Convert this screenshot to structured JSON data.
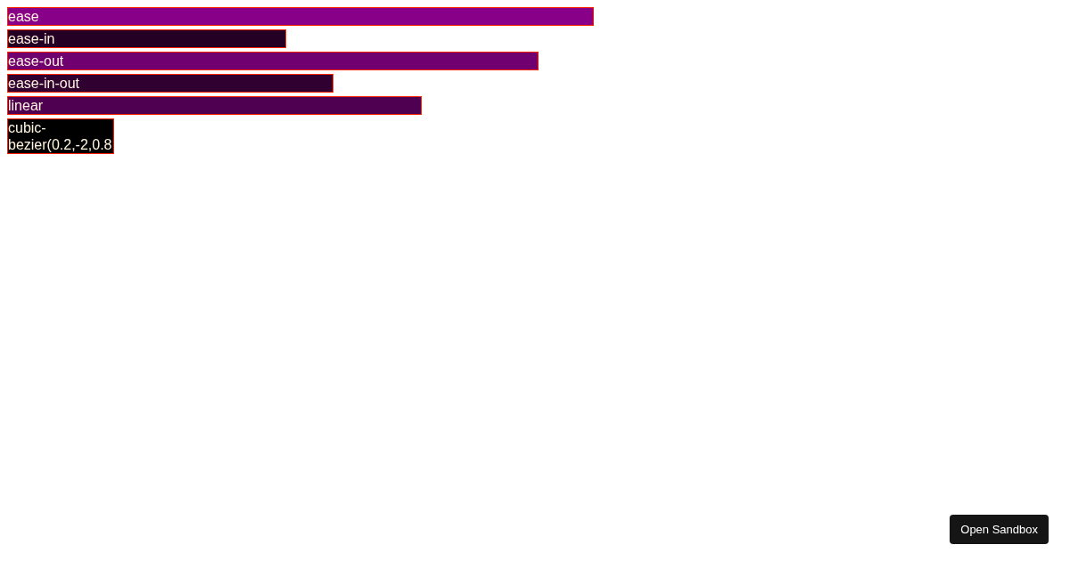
{
  "bars": [
    {
      "label": "ease",
      "level": 0.556,
      "color": "#880088"
    },
    {
      "label": "ease-in",
      "level": 0.264,
      "color": "#250025"
    },
    {
      "label": "ease-out",
      "level": 0.503,
      "color": "#700070"
    },
    {
      "label": "ease-in-out",
      "level": 0.309,
      "color": "#300030"
    },
    {
      "label": "linear",
      "level": 0.393,
      "color": "#500050"
    },
    {
      "label": "cubic-bezier(0.2,-2,0.8",
      "level": 0.101,
      "color": "#000000"
    }
  ],
  "sandbox_button": "Open Sandbox"
}
